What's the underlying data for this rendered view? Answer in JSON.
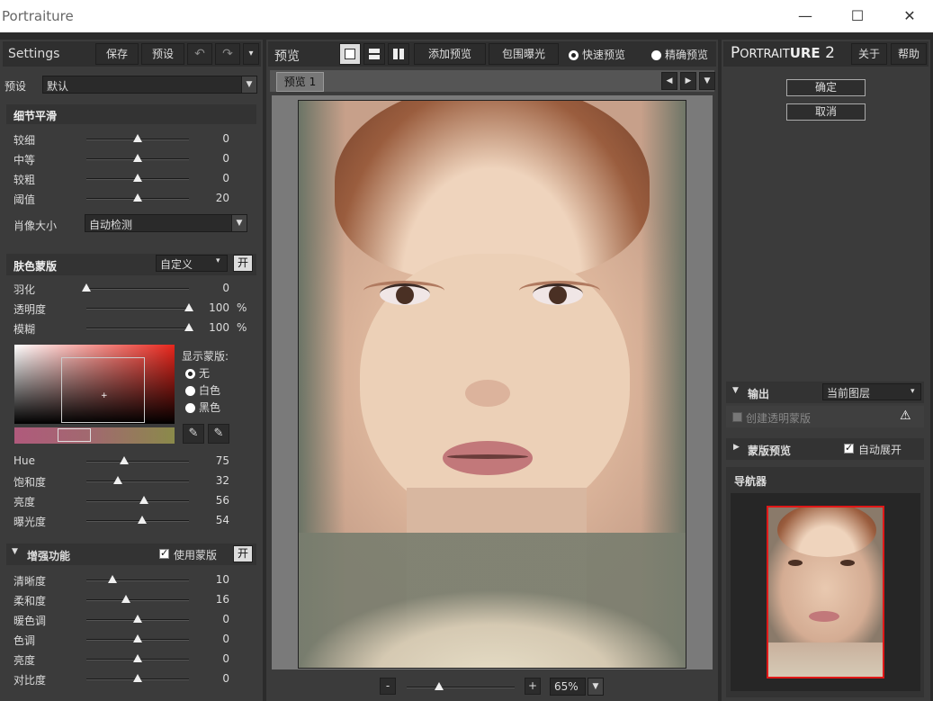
{
  "window": {
    "title": "Portraiture",
    "minimize": "—",
    "maximize": "☐",
    "close": "✕"
  },
  "left": {
    "title": "Settings",
    "save": "保存",
    "preset_btn": "预设",
    "undo": "↶",
    "redo": "↷",
    "menu": "▾",
    "preset_label": "预设",
    "preset_value": "默认",
    "detail": {
      "title": "细节平滑",
      "rows": [
        {
          "label": "较细",
          "value": "0",
          "pos": 0.5
        },
        {
          "label": "中等",
          "value": "0",
          "pos": 0.5
        },
        {
          "label": "较粗",
          "value": "0",
          "pos": 0.5
        },
        {
          "label": "阈值",
          "value": "20",
          "pos": 0.5
        }
      ],
      "size_label": "肖像大小",
      "size_value": "自动检测"
    },
    "skin": {
      "title": "肤色蒙版",
      "mode": "自定义",
      "toggle": "开",
      "rows": [
        {
          "label": "羽化",
          "value": "0",
          "unit": "",
          "pos": 0.0
        },
        {
          "label": "透明度",
          "value": "100",
          "unit": "%",
          "pos": 1.0
        },
        {
          "label": "模糊",
          "value": "100",
          "unit": "%",
          "pos": 1.0
        }
      ],
      "show_mask_label": "显示蒙版:",
      "options": [
        "无",
        "白色",
        "黑色"
      ],
      "selected": 0,
      "hsl": [
        {
          "label": "Hue",
          "value": "75",
          "pos": 0.37
        },
        {
          "label": "饱和度",
          "value": "32",
          "pos": 0.31
        },
        {
          "label": "亮度",
          "value": "56",
          "pos": 0.56
        },
        {
          "label": "曝光度",
          "value": "54",
          "pos": 0.54
        }
      ]
    },
    "enhance": {
      "title": "增强功能",
      "use_mask": "使用蒙版",
      "toggle": "开",
      "rows": [
        {
          "label": "清晰度",
          "value": "10",
          "pos": 0.25
        },
        {
          "label": "柔和度",
          "value": "16",
          "pos": 0.39
        },
        {
          "label": "暖色调",
          "value": "0",
          "pos": 0.5
        },
        {
          "label": "色调",
          "value": "0",
          "pos": 0.5
        },
        {
          "label": "亮度",
          "value": "0",
          "pos": 0.5
        },
        {
          "label": "对比度",
          "value": "0",
          "pos": 0.5
        }
      ]
    }
  },
  "center": {
    "title": "预览",
    "add_preview": "添加预览",
    "bracket": "包围曝光",
    "fast": "快速预览",
    "precise": "精确预览",
    "tab": "预览 1",
    "zoom_minus": "-",
    "zoom_plus": "+",
    "zoom_value": "65%",
    "zoom_pos": 0.3
  },
  "right": {
    "title_p": "P",
    "title_small": "ORTRAIT",
    "title_u": "URE",
    "title_num": " 2",
    "about": "关于",
    "help": "帮助",
    "ok": "确定",
    "cancel": "取消",
    "output_label": "输出",
    "output_value": "当前图层",
    "create_mask": "创建透明蒙版",
    "warn": "⚠",
    "mask_preview": "蒙版预览",
    "auto_expand": "自动展开",
    "navigator": "导航器"
  }
}
